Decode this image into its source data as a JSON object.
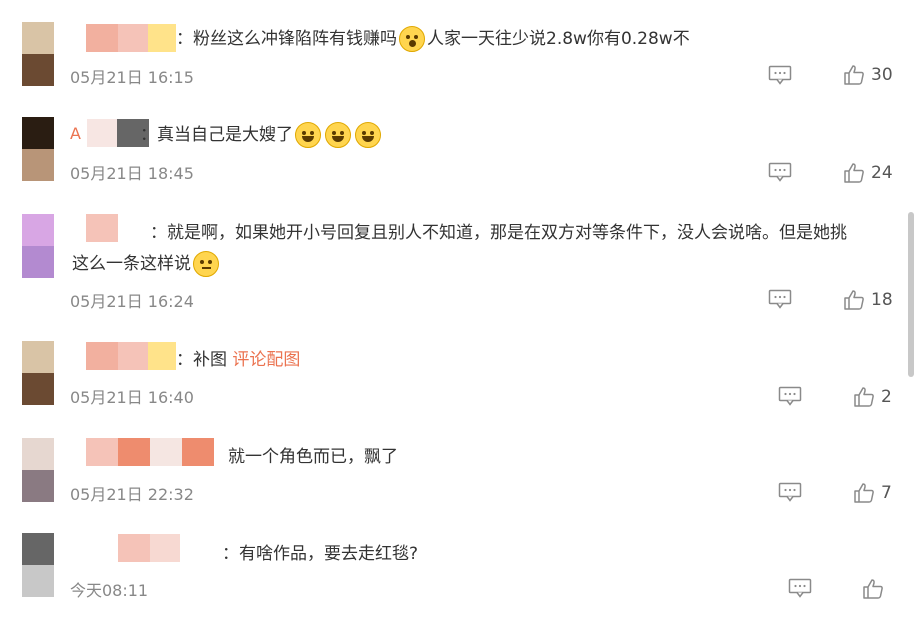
{
  "comments": [
    {
      "text": "：粉丝这么冲锋陷阵有钱赚吗",
      "text_after": "人家一天往少说2.8w你有0.28w不",
      "time": "05月21日 16:15",
      "likes": "30",
      "avatar_colors": [
        "#d9c4a6",
        "#6b4a32"
      ],
      "nick_colors": [
        "#f2b09f",
        "#f5c3b8",
        "#ffe38a"
      ],
      "emojis": [
        "shocked-emoji"
      ]
    },
    {
      "nick_prefix": "A",
      "text": "：真当自己是大嫂了",
      "time": "05月21日 18:45",
      "likes": "24",
      "avatar_colors": [
        "#2a1d12",
        "#b89578"
      ],
      "nick_colors": [
        "#f7e6e3",
        "#666666"
      ],
      "emojis": [
        "laughing-tears-emoji",
        "laughing-tears-emoji",
        "laughing-tears-emoji"
      ]
    },
    {
      "text": "：就是啊，如果她开小号回复且别人不知道，那是在双方对等条件下，没人会说啥。但是她挑",
      "text_line2": "这么一条这样说",
      "time": "05月21日 16:24",
      "likes": "18",
      "avatar_colors": [
        "#d8a6e4",
        "#b38ad0"
      ],
      "nick_colors": [
        "#f5c3b8"
      ],
      "emojis": [
        "shrug-emoji"
      ]
    },
    {
      "text": "：补图",
      "link": "评论配图",
      "time": "05月21日 16:40",
      "likes": "2",
      "avatar_colors": [
        "#d9c4a6",
        "#6b4a32"
      ],
      "nick_colors": [
        "#f2b09f",
        "#f5c3b8",
        "#ffe38a"
      ],
      "emojis": []
    },
    {
      "text": "就一个角色而已，飘了",
      "time": "05月21日 22:32",
      "likes": "7",
      "avatar_colors": [
        "#e6d7d0",
        "#8a7a82"
      ],
      "nick_colors": [
        "#f5c3b8",
        "#ee8c6e",
        "#f5e6e2",
        "#ee8c6e"
      ],
      "emojis": []
    },
    {
      "text": "：有啥作品，要去走红毯?",
      "time": "今天08:11",
      "likes": "",
      "avatar_colors": [
        "#666666",
        "#c8c8c8"
      ],
      "nick_colors": [
        "#f5c3b8",
        "#f7d9d2"
      ],
      "emojis": []
    }
  ],
  "colors": {
    "link": "#eb7350",
    "meta_text": "#888888",
    "icon": "#8a8a8a"
  }
}
